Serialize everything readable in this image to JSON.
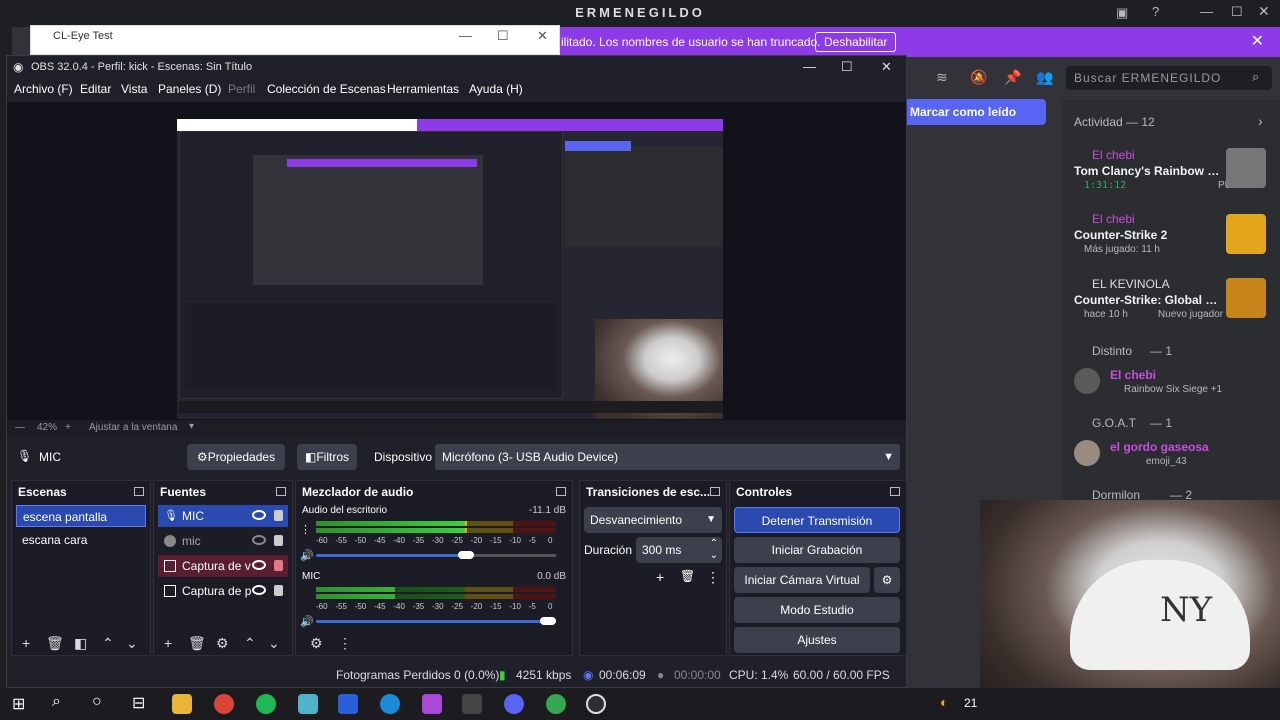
{
  "discord": {
    "title": "ERMENEGILDO",
    "notice_text": "ilitado. Los nombres de usuario se han truncado.",
    "notice_button": "Deshabilitar",
    "search_placeholder": "Buscar ERMENEGILDO",
    "mark_read": "Marcar como leído",
    "activity_header": "Actividad — 12",
    "activities": [
      {
        "user": "El chebi",
        "game": "Tom Clancy's Rainbow Six ...",
        "detail": "1:31:12",
        "tag": "PUB..."
      },
      {
        "user": "El chebi",
        "game": "Counter-Strike 2",
        "detail": "Más jugado: 11 h"
      },
      {
        "user": "EL KEVINOLA",
        "game": "Counter-Strike: Global Off...",
        "detail": "hace 10 h",
        "tag": "Nuevo jugador"
      }
    ],
    "groups": [
      {
        "title": "Distinto",
        "count": "— 1",
        "member": "El chebi",
        "sub": "Rainbow Six Siege +1"
      },
      {
        "title": "G.O.A.T",
        "count": "— 1",
        "member": "el gordo gaseosa",
        "sub": "emoji_43"
      },
      {
        "title": "Dormilon",
        "count": "— 2"
      }
    ],
    "cap_text": "NY"
  },
  "cleye": {
    "title": "CL-Eye Test"
  },
  "obs": {
    "title": "OBS 32.0.4 - Perfil: kick - Escenas: Sin Título",
    "menu": [
      "Archivo (F)",
      "Editar",
      "Vista",
      "Paneles (D)",
      "Perfil",
      "Colección de Escenas",
      "Herramientas",
      "Ayuda (H)"
    ],
    "zoom": "42%",
    "fit_label": "Ajustar a la ventana",
    "source_label": "MIC",
    "properties_btn": "Propiedades",
    "filters_btn": "Filtros",
    "device_label": "Dispositivo",
    "device_value": "Micrófono (3- USB Audio Device)",
    "scenes": {
      "title": "Escenas",
      "items": [
        "escena pantalla",
        "escana cara"
      ]
    },
    "sources": {
      "title": "Fuentes",
      "items": [
        "MIC",
        "mic",
        "Captura de v",
        "Captura de p"
      ]
    },
    "mixer": {
      "title": "Mezclador de audio",
      "channels": [
        {
          "name": "Audio del escritorio",
          "db": "-11.1 dB",
          "level": 0.63
        },
        {
          "name": "MIC",
          "db": "0.0 dB",
          "level": 0.33
        }
      ],
      "ticks": [
        "-60",
        "-55",
        "-50",
        "-45",
        "-40",
        "-35",
        "-30",
        "-25",
        "-20",
        "-15",
        "-10",
        "-5",
        "0"
      ]
    },
    "transitions": {
      "title": "Transiciones de esc...",
      "value": "Desvanecimiento",
      "duration_label": "Duración",
      "duration_value": "300 ms"
    },
    "controls": {
      "title": "Controles",
      "buttons": [
        "Detener Transmisión",
        "Iniciar Grabación",
        "Iniciar Cámara Virtual",
        "Modo Estudio",
        "Ajustes"
      ]
    },
    "status": {
      "dropped": "Fotogramas Perdidos 0 (0.0%)",
      "bitrate": "4251 kbps",
      "stream_time": "00:06:09",
      "rec_time": "00:00:00",
      "cpu": "CPU: 1.4%",
      "fps": "60.00 / 60.00 FPS"
    }
  },
  "taskbar": {
    "tray_text": "21"
  },
  "colors": {
    "accent": "#2a4ab0",
    "discord_notice": "#8c3be6",
    "obs_bg": "#1f2029"
  }
}
